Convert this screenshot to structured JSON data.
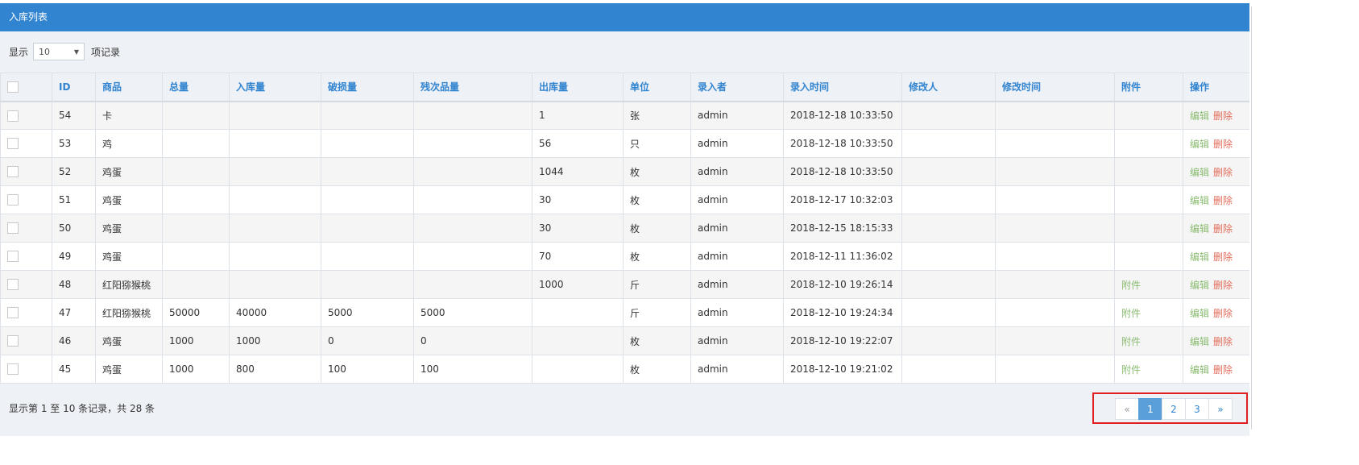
{
  "panel": {
    "title": "入库列表"
  },
  "length": {
    "prefix": "显示",
    "value": "10",
    "suffix": "项记录"
  },
  "table": {
    "headers": [
      "ID",
      "商品",
      "总量",
      "入库量",
      "破损量",
      "残次品量",
      "出库量",
      "单位",
      "录入者",
      "录入时间",
      "修改人",
      "修改时间",
      "附件",
      "操作"
    ],
    "edit_label": "编辑",
    "delete_label": "删除",
    "rows": [
      {
        "id": "54",
        "product": "卡",
        "total": "",
        "in_qty": "",
        "damaged": "",
        "defective": "",
        "out_qty": "1",
        "unit": "张",
        "creator": "admin",
        "created_at": "2018-12-18 10:33:50",
        "modifier": "",
        "modified_at": "",
        "attachment": ""
      },
      {
        "id": "53",
        "product": "鸡",
        "total": "",
        "in_qty": "",
        "damaged": "",
        "defective": "",
        "out_qty": "56",
        "unit": "只",
        "creator": "admin",
        "created_at": "2018-12-18 10:33:50",
        "modifier": "",
        "modified_at": "",
        "attachment": ""
      },
      {
        "id": "52",
        "product": "鸡蛋",
        "total": "",
        "in_qty": "",
        "damaged": "",
        "defective": "",
        "out_qty": "1044",
        "unit": "枚",
        "creator": "admin",
        "created_at": "2018-12-18 10:33:50",
        "modifier": "",
        "modified_at": "",
        "attachment": ""
      },
      {
        "id": "51",
        "product": "鸡蛋",
        "total": "",
        "in_qty": "",
        "damaged": "",
        "defective": "",
        "out_qty": "30",
        "unit": "枚",
        "creator": "admin",
        "created_at": "2018-12-17 10:32:03",
        "modifier": "",
        "modified_at": "",
        "attachment": ""
      },
      {
        "id": "50",
        "product": "鸡蛋",
        "total": "",
        "in_qty": "",
        "damaged": "",
        "defective": "",
        "out_qty": "30",
        "unit": "枚",
        "creator": "admin",
        "created_at": "2018-12-15 18:15:33",
        "modifier": "",
        "modified_at": "",
        "attachment": ""
      },
      {
        "id": "49",
        "product": "鸡蛋",
        "total": "",
        "in_qty": "",
        "damaged": "",
        "defective": "",
        "out_qty": "70",
        "unit": "枚",
        "creator": "admin",
        "created_at": "2018-12-11 11:36:02",
        "modifier": "",
        "modified_at": "",
        "attachment": ""
      },
      {
        "id": "48",
        "product": "红阳猕猴桃",
        "total": "",
        "in_qty": "",
        "damaged": "",
        "defective": "",
        "out_qty": "1000",
        "unit": "斤",
        "creator": "admin",
        "created_at": "2018-12-10 19:26:14",
        "modifier": "",
        "modified_at": "",
        "attachment": "附件"
      },
      {
        "id": "47",
        "product": "红阳猕猴桃",
        "total": "50000",
        "in_qty": "40000",
        "damaged": "5000",
        "defective": "5000",
        "out_qty": "",
        "unit": "斤",
        "creator": "admin",
        "created_at": "2018-12-10 19:24:34",
        "modifier": "",
        "modified_at": "",
        "attachment": "附件"
      },
      {
        "id": "46",
        "product": "鸡蛋",
        "total": "1000",
        "in_qty": "1000",
        "damaged": "0",
        "defective": "0",
        "out_qty": "",
        "unit": "枚",
        "creator": "admin",
        "created_at": "2018-12-10 19:22:07",
        "modifier": "",
        "modified_at": "",
        "attachment": "附件"
      },
      {
        "id": "45",
        "product": "鸡蛋",
        "total": "1000",
        "in_qty": "800",
        "damaged": "100",
        "defective": "100",
        "out_qty": "",
        "unit": "枚",
        "creator": "admin",
        "created_at": "2018-12-10 19:21:02",
        "modifier": "",
        "modified_at": "",
        "attachment": "附件"
      }
    ]
  },
  "info": {
    "text": "显示第 1 至 10 条记录，共 28 条"
  },
  "pagination": {
    "prev_icon": "«",
    "pages": [
      "1",
      "2",
      "3"
    ],
    "current": "1",
    "next_icon": "»"
  }
}
